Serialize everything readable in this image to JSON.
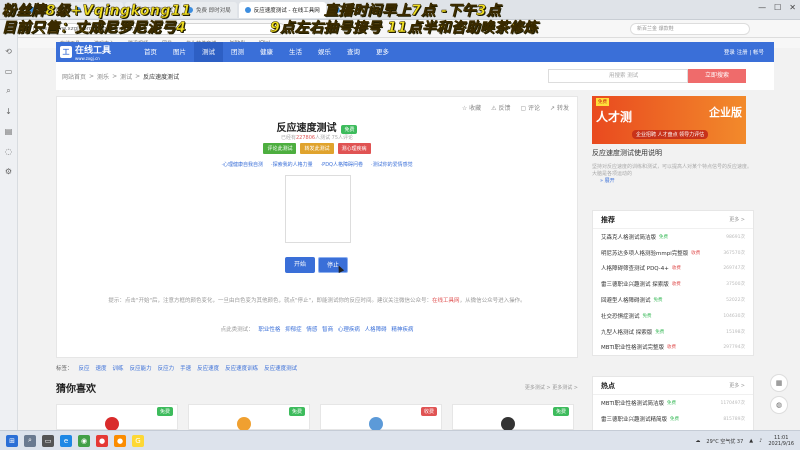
{
  "overlay": {
    "line1": "粉丝牌8级+Vqingkong11",
    "line2": "目前只售：丈成尼罗尼泥弓4",
    "line3": "直播时间早上7点 -下午3点",
    "line4": "9点左右抽号接号 11点半和咨助唤茶修炼"
  },
  "browser": {
    "tabs": [
      "我的主页",
      "《三国演义》",
      "反应速度测试",
      "免费 即时对局",
      "反应速度测试 - 在线工具网",
      "工作"
    ],
    "url": "https://www.xzgj.com/tongji/fanying/sudu",
    "search_placeholder": "新百兰金 爆款鞋",
    "bookmarks": [
      "在线工具",
      "游戏中心",
      "腾讯视频",
      "网易",
      "华为软件商城",
      "bilibili",
      "iQiyi"
    ]
  },
  "site": {
    "logo_main": "在线工具",
    "logo_sub": "www.zxgj.cn",
    "nav": [
      "首页",
      "图片",
      "测试",
      "团测",
      "健康",
      "生活",
      "娱乐",
      "查询",
      "更多"
    ],
    "nav_active_index": 2,
    "header_right": "登录 注册 | 帐号"
  },
  "breadcrumb": {
    "items": [
      "网站首页",
      "测乐",
      "测试",
      "反应速度测试"
    ],
    "search_placeholder": "用搜索 测试",
    "search_button": "立即搜索"
  },
  "test": {
    "actions": [
      "收藏",
      "反馈",
      "评论",
      "转发"
    ],
    "title": "反应速度测试",
    "badge": "免费",
    "meta_prefix": "已经有",
    "meta_count": "227806",
    "meta_suffix": "人测试   75人评论",
    "tag_buttons": [
      "评论此测试",
      "转发此测试",
      "测心理疾病"
    ],
    "links": [
      "·心理健康自我自测",
      "·探索我的人格力量",
      "·PDQ人格障碍问卷",
      "·测试你的爱情感觉"
    ],
    "start_button": "开始",
    "stop_button": "停止",
    "tip_text": "提示：点击\"开始\"后，注意方框的颜色变化，一旦由白色变为其他颜色，就点\"停止\"，即能测试你的反应时间。建议关注微信公众号：",
    "tip_highlight": "在线工具网",
    "tip_tail": "，从微信公众号进入操作。",
    "related_label": "点此类测试：",
    "related": [
      "职业性格",
      "抑郁症",
      "情感",
      "智商",
      "心理疾病",
      "人格障碍",
      "精神疾病"
    ]
  },
  "tags": {
    "label": "标签：",
    "items": [
      "反应",
      "速度",
      "训练",
      "反应能力",
      "反应力",
      "手速",
      "反应速度",
      "反应速度训练",
      "反应速度测试"
    ]
  },
  "guess": {
    "title": "猜你喜欢",
    "more": "更多测试 >  更多测试 >",
    "cards": [
      {
        "badge": "免费",
        "badge_color": "#3dbb5c",
        "icon_color": "#d92b2b"
      },
      {
        "badge": "免费",
        "badge_color": "#3dbb5c",
        "icon_color": "#f0a030"
      },
      {
        "badge": "收费",
        "badge_color": "#e05353",
        "icon_color": "#5c9ad8"
      },
      {
        "badge": "免费",
        "badge_color": "#3dbb5c",
        "icon_color": "#333333"
      }
    ]
  },
  "banner": {
    "tag": "免费",
    "left": "人才测",
    "right": "企业版",
    "sub": "企业招聘 人才盘点 领导力评估"
  },
  "intro": {
    "title": "反应速度测试使用说明",
    "text": "坚持对反应速度的训练和测试，可以提高人对某个特点信号的反应速度。大脑是各项运动的",
    "more": "展开"
  },
  "recommend": {
    "title": "推荐",
    "more": "更多 >",
    "items": [
      {
        "name": "艾森克人格测试简洁版",
        "badge": "免费",
        "type": "free",
        "count": "98691次"
      },
      {
        "name": "明尼苏达多项人格测验mmpi完整版",
        "badge": "收费",
        "type": "pay",
        "count": "367570次"
      },
      {
        "name": "人格障碍筛查测试 PDQ-4+",
        "badge": "收费",
        "type": "pay",
        "count": "269747次"
      },
      {
        "name": "雷三德职业兴趣测试 探索版",
        "badge": "收费",
        "type": "pay",
        "count": "37500次"
      },
      {
        "name": "回避型人格障碍测试",
        "badge": "免费",
        "type": "free",
        "count": "52022次"
      },
      {
        "name": "社交恐惧症测试",
        "badge": "免费",
        "type": "free",
        "count": "104630次"
      },
      {
        "name": "九型人格测试 探索版",
        "badge": "免费",
        "type": "free",
        "count": "15198次"
      },
      {
        "name": "MBTI职业性格测试完整版",
        "badge": "收费",
        "type": "pay",
        "count": "297794次"
      }
    ]
  },
  "hot": {
    "title": "热点",
    "more": "更多 >",
    "items": [
      {
        "name": "MBTI职业性格测试简洁版",
        "badge": "免费",
        "type": "free",
        "count": "1170497次"
      },
      {
        "name": "雷三德职业兴趣测试精简版",
        "badge": "免费",
        "type": "free",
        "count": "815789次"
      },
      {
        "name": "九型人格测试 简洁版",
        "badge": "免费",
        "type": "free",
        "count": "728089次"
      }
    ]
  },
  "taskbar": {
    "weather": "29°C 空气优 37",
    "time": "11:01",
    "date": "2021/9/16"
  }
}
